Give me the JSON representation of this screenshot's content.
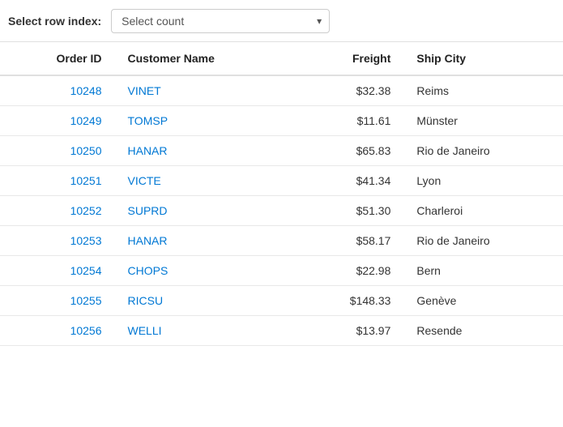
{
  "header": {
    "label": "Select row index:",
    "dropdown_placeholder": "Select count",
    "chevron": "▾"
  },
  "table": {
    "columns": [
      {
        "key": "orderid",
        "label": "Order ID"
      },
      {
        "key": "customer",
        "label": "Customer Name"
      },
      {
        "key": "freight",
        "label": "Freight"
      },
      {
        "key": "shipcity",
        "label": "Ship City"
      }
    ],
    "rows": [
      {
        "orderid": "10248",
        "customer": "VINET",
        "freight": "$32.38",
        "shipcity": "Reims"
      },
      {
        "orderid": "10249",
        "customer": "TOMSP",
        "freight": "$11.61",
        "shipcity": "Münster"
      },
      {
        "orderid": "10250",
        "customer": "HANAR",
        "freight": "$65.83",
        "shipcity": "Rio de Janeiro"
      },
      {
        "orderid": "10251",
        "customer": "VICTE",
        "freight": "$41.34",
        "shipcity": "Lyon"
      },
      {
        "orderid": "10252",
        "customer": "SUPRD",
        "freight": "$51.30",
        "shipcity": "Charleroi"
      },
      {
        "orderid": "10253",
        "customer": "HANAR",
        "freight": "$58.17",
        "shipcity": "Rio de Janeiro"
      },
      {
        "orderid": "10254",
        "customer": "CHOPS",
        "freight": "$22.98",
        "shipcity": "Bern"
      },
      {
        "orderid": "10255",
        "customer": "RICSU",
        "freight": "$148.33",
        "shipcity": "Genève"
      },
      {
        "orderid": "10256",
        "customer": "WELLI",
        "freight": "$13.97",
        "shipcity": "Resende"
      }
    ]
  }
}
